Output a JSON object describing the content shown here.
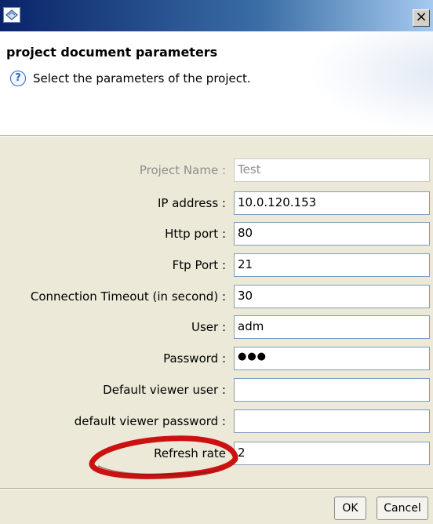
{
  "window": {
    "close_glyph": "×"
  },
  "header": {
    "title": "project document parameters",
    "help_glyph": "?",
    "message": "Select the parameters of the project."
  },
  "form": {
    "project_name": {
      "label": "Project Name :",
      "value": "Test",
      "enabled": false
    },
    "ip_address": {
      "label": "IP address :",
      "value": "10.0.120.153"
    },
    "http_port": {
      "label": "Http port :",
      "value": "80"
    },
    "ftp_port": {
      "label": "Ftp Port :",
      "value": "21"
    },
    "connection_timeout": {
      "label": "Connection Timeout (in second) :",
      "value": "30"
    },
    "user": {
      "label": "User :",
      "value": "adm"
    },
    "password": {
      "label": "Password :",
      "value": "●●●"
    },
    "default_viewer_user": {
      "label": "Default viewer user :",
      "value": ""
    },
    "default_viewer_password": {
      "label": "default viewer password :",
      "value": ""
    },
    "refresh_rate": {
      "label": "Refresh rate",
      "value": "2"
    }
  },
  "buttons": {
    "ok": "OK",
    "cancel": "Cancel"
  },
  "annotation": {
    "color": "#cc1111",
    "target": "refresh_rate"
  },
  "colors": {
    "titlebar_start": "#0a246a",
    "titlebar_end": "#a6caf0",
    "dialog_bg": "#ece9d8"
  }
}
